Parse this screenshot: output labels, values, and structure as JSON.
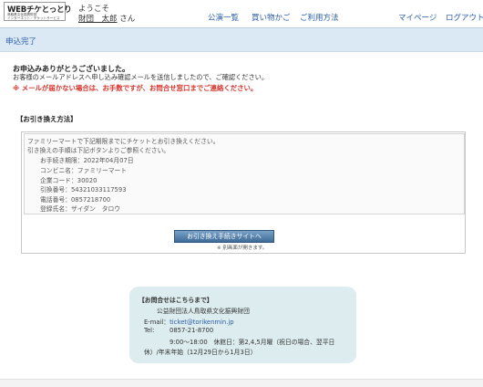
{
  "header": {
    "logo": {
      "main": "WEBチケとっとり",
      "sub_line1": "鳥取県文化振興財団",
      "sub_line2": "インターネット・チケットサービス"
    },
    "welcome": "ようこそ",
    "user_name": "財団　太郎",
    "user_suffix": "さん",
    "nav": {
      "events": "公演一覧",
      "cart": "買い物かご",
      "guide": "ご利用方法",
      "mypage": "マイページ",
      "logout": "ログアウト"
    }
  },
  "page_title": "申込完了",
  "messages": {
    "thanks": "お申込みありがとうございました。",
    "email_sent": "お客様のメールアドレスへ申し込み確認メールを送信しましたので、ご確認ください。",
    "warning": "※ メールが届かない場合は、お手数ですが、お問合せ窓口までご連絡ください。"
  },
  "exchange": {
    "heading": "【お引き換え方法】",
    "intro1": "ファミリーマートで下記期限までにチケットとお引き換えください。",
    "intro2": "引き換えの手順は下記ボタンよりご参照ください。",
    "deadline": "お手続き期限：2022年04月07日",
    "store": "コンビニ名：ファミリーマート",
    "company_code": "企業コード：30020",
    "exchange_number": "引換番号：54321033117593",
    "phone": "電話番号：0857218700",
    "registrant": "登録氏名：ザイダン　タロウ",
    "button_label": "お引き換え手続きサイトへ",
    "button_note": "※ 別画面が開きます。"
  },
  "contact": {
    "heading": "【お問合せはこちらまで】",
    "org": "公益財団法人鳥取県文化振興財団",
    "email_label": "E-mail：",
    "email": "ticket@torikenmin.jp",
    "tel_label": "Tel:",
    "tel": "0857-21-8700",
    "hours1": "9:00～18:00　休館日：第2,4,5月曜（祝日の場合、翌平日",
    "hours2": "休）/年末年始（12月29日から1月3日）"
  }
}
